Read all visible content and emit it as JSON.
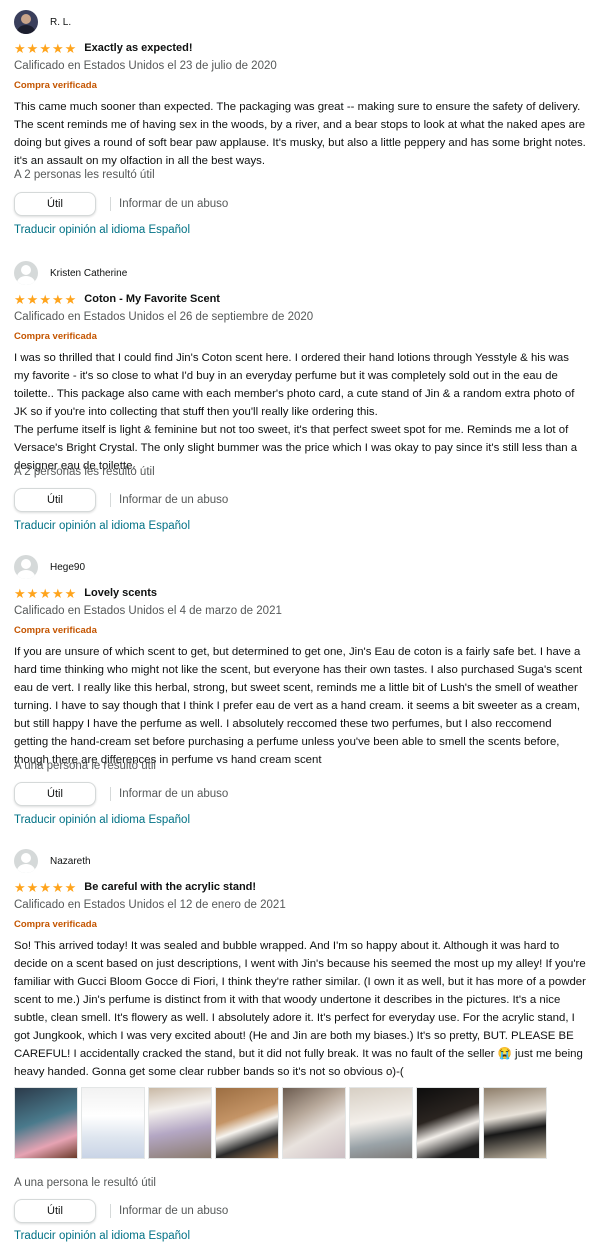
{
  "reviews": [
    {
      "reviewer": "R. L.",
      "stars": 5,
      "title": "Exactly as expected!",
      "date": "Calificado en Estados Unidos el 23 de julio de 2020",
      "verified": "Compra verificada",
      "body": "This came much sooner than expected. The packaging was great -- making sure to ensure the safety of delivery. The scent reminds me of having sex in the woods, by a river, and a bear stops to look at what the naked apes are doing but gives a round of soft bear paw applause. It's musky, but also a little peppery and has some bright notes. it's an assault on my olfaction in all the best ways.",
      "helpful": "A 2 personas les resultó útil",
      "util_label": "Útil",
      "abuse_label": "Informar de un abuso",
      "translate_label": "Traducir opinión al idioma Español"
    },
    {
      "reviewer": "Kristen Catherine",
      "stars": 5,
      "title": "Coton - My Favorite Scent",
      "date": "Calificado en Estados Unidos el 26 de septiembre de 2020",
      "verified": "Compra verificada",
      "body": "I was so thrilled that I could find Jin's Coton scent here. I ordered their hand lotions through Yesstyle & his was my favorite - it's so close to what I'd buy in an everyday perfume but it was completely sold out in the eau de toilette.. This package also came with each member's photo card, a cute stand of Jin & a random extra photo of JK so if you're into collecting that stuff then you'll really like ordering this.\nThe perfume itself is light & feminine but not too sweet, it's that perfect sweet spot for me. Reminds me a lot of Versace's Bright Crystal. The only slight bummer was the price which I was okay to pay since it's still less than a designer eau de toilette.",
      "helpful": "A 2 personas les resultó útil",
      "util_label": "Útil",
      "abuse_label": "Informar de un abuso",
      "translate_label": "Traducir opinión al idioma Español"
    },
    {
      "reviewer": "Hege90",
      "stars": 5,
      "title": "Lovely scents",
      "date": "Calificado en Estados Unidos el 4 de marzo de 2021",
      "verified": "Compra verificada",
      "body": "If you are unsure of which scent to get, but determined to get one, Jin's Eau de coton is a fairly safe bet. I have a hard time thinking who might not like the scent, but everyone has their own tastes. I also purchased Suga's scent eau de vert. I really like this herbal, strong, but sweet scent, reminds me a little bit of Lush's the smell of weather turning. I have to say though that I think I prefer eau de vert as a hand cream. it seems a bit sweeter as a cream, but still happy I have the perfume as well. I absolutely reccomed these two perfumes, but I also reccomend getting the hand-cream set before purchasing a perfume unless you've been able to smell the scents before, though there are differences in perfume vs hand cream scent",
      "helpful": "A una persona le resultó útil",
      "util_label": "Útil",
      "abuse_label": "Informar de un abuso",
      "translate_label": "Traducir opinión al idioma Español"
    },
    {
      "reviewer": "Nazareth",
      "stars": 5,
      "title": "Be careful with the acrylic stand!",
      "date": "Calificado en Estados Unidos el 12 de enero de 2021",
      "verified": "Compra verificada",
      "body": "So! This arrived today! It was sealed and bubble wrapped. And I'm so happy about it. Although it was hard to decide on a scent based on just descriptions, I went with Jin's because his seemed the most up my alley! If you're familiar with Gucci Bloom Gocce di Fiori, I think they're rather similar. (I own it as well, but it has more of a powder scent to me.) Jin's perfume is distinct from it with that woody undertone it describes in the pictures. It's a nice subtle, clean smell. It's flowery as well. I absolutely adore it. It's perfect for everyday use. For the acrylic stand, I got Jungkook, which I was very excited about! (He and Jin are both my biases.) It's so pretty, BUT. PLEASE BE CAREFUL! I accidentally cracked the stand, but it did not fully break. It was no fault of the seller 😭 just me being heavy handed. Gonna get some clear rubber bands so it's not so obvious o)-(",
      "helpful": "A una persona le resultó útil",
      "util_label": "Útil",
      "abuse_label": "Informar de un abuso",
      "translate_label": "Traducir opinión al idioma Español"
    }
  ],
  "colors": {
    "star": "#ffa41c",
    "verified": "#c45500",
    "link": "#007185",
    "muted": "#565959"
  },
  "icons": [
    "avatar-icon",
    "star-icon"
  ]
}
